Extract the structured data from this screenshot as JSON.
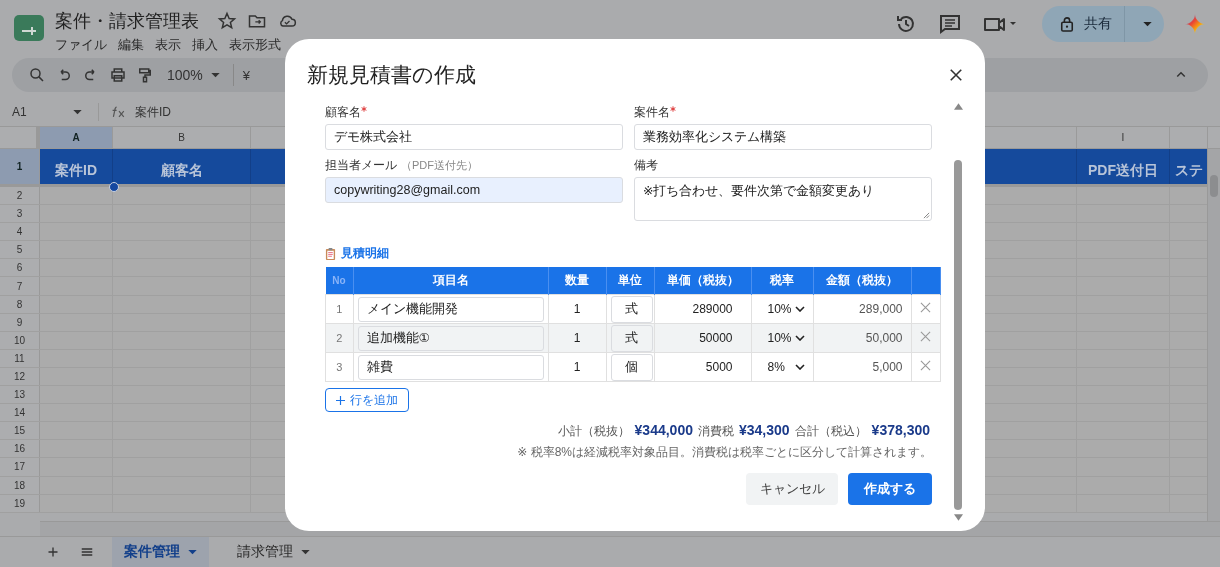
{
  "document": {
    "title": "案件・請求管理表"
  },
  "menu": [
    "ファイル",
    "編集",
    "表示",
    "挿入",
    "表示形式"
  ],
  "toolbar": {
    "zoom": "100%",
    "currency": "¥"
  },
  "share": {
    "label": "共有"
  },
  "formula_bar": {
    "cell": "A1",
    "formula": "案件ID"
  },
  "columns": [
    {
      "letter": "A",
      "header": "案件ID",
      "selected": true
    },
    {
      "letter": "B",
      "header": "顧客名",
      "selected": false
    },
    {
      "selected": false
    },
    {
      "letter": "I",
      "header": "PDF送付日",
      "selected": false
    },
    {
      "header": "ステ",
      "selected": false
    }
  ],
  "row_numbers": [
    "1",
    "2",
    "3",
    "4",
    "5",
    "6",
    "7",
    "8",
    "9",
    "10",
    "11",
    "12",
    "13",
    "14",
    "15",
    "16",
    "17",
    "18",
    "19"
  ],
  "sheet_tabs": [
    {
      "label": "案件管理",
      "selected": true
    },
    {
      "label": "請求管理",
      "selected": false
    }
  ],
  "dialog": {
    "title": "新規見積書の作成",
    "fields": [
      {
        "kind": "input",
        "label": "顧客名",
        "required": true,
        "value": "デモ株式会社",
        "autofilled": false
      },
      {
        "kind": "input",
        "label": "案件名",
        "required": true,
        "value": "業務効率化システム構築",
        "autofilled": false
      },
      {
        "kind": "input",
        "label": "担当者メール",
        "hint": "（PDF送付先）",
        "required": false,
        "value": "copywriting28@gmail.com",
        "autofilled": true
      },
      {
        "kind": "textarea",
        "label": "備考",
        "required": false,
        "value": "※打ち合わせ、要件次第で金額変更あり",
        "autofilled": false
      }
    ],
    "section_title": "見積明細",
    "table_columns": [
      "No",
      "項目名",
      "数量",
      "単位",
      "単価（税抜）",
      "税率",
      "金額（税抜）"
    ],
    "rows": [
      {
        "no": "1",
        "item": "メイン機能開発",
        "qty": "1",
        "unit": "式",
        "price": "289000",
        "tax": "10%",
        "amount": "289,000",
        "highlighted": false
      },
      {
        "no": "2",
        "item": "追加機能①",
        "qty": "1",
        "unit": "式",
        "price": "50000",
        "tax": "10%",
        "amount": "50,000",
        "highlighted": true
      },
      {
        "no": "3",
        "item": "雑費",
        "qty": "1",
        "unit": "個",
        "price": "5000",
        "tax": "8%",
        "amount": "5,000",
        "highlighted": false
      }
    ],
    "add_row_button": "行を追加",
    "totals": [
      {
        "label": "小計（税抜）",
        "value": "¥344,000"
      },
      {
        "label": "消費税",
        "value": "¥34,300"
      },
      {
        "label": "合計（税込）",
        "value": "¥378,300"
      }
    ],
    "note": "※ 税率8%は経減税率対象品目。消費税は税率ごとに区分して計算されます。",
    "buttons": [
      {
        "kind": "secondary",
        "label": "キャンセル"
      },
      {
        "kind": "primary",
        "label": "作成する"
      }
    ]
  }
}
